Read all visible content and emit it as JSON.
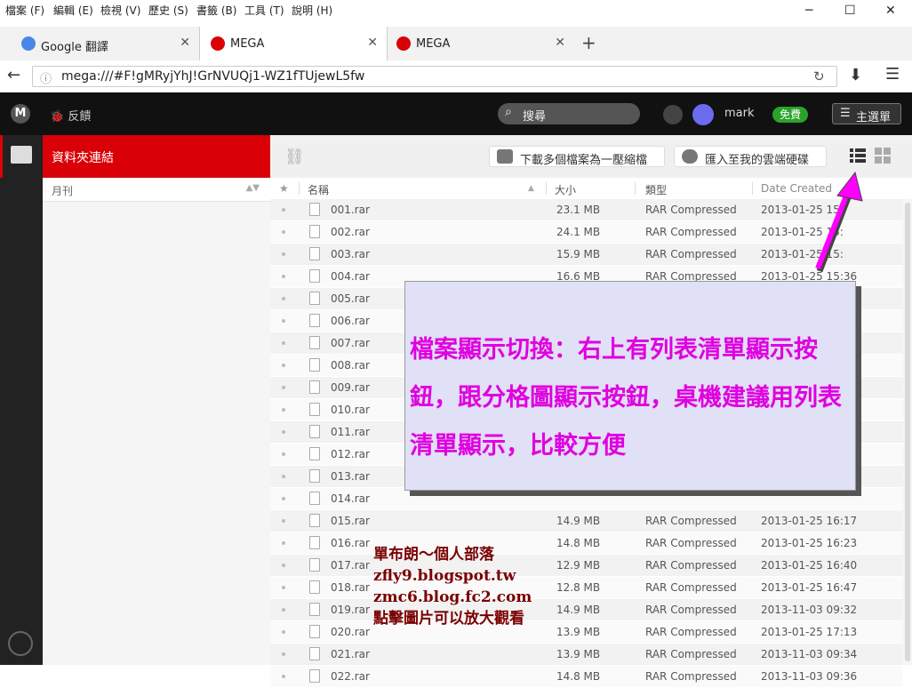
{
  "menubar": {
    "items": [
      "檔案 (F)",
      "編輯 (E)",
      "檢視 (V)",
      "歷史 (S)",
      "書籤 (B)",
      "工具 (T)",
      "說明 (H)"
    ]
  },
  "tabs": [
    {
      "label": "Google 翻譯",
      "icon": "google-translate-icon"
    },
    {
      "label": "MEGA",
      "icon": "mega-icon",
      "active": true
    },
    {
      "label": "MEGA",
      "icon": "mega-icon"
    }
  ],
  "url": "mega:///#F!gMRyjYhJ!GrNVUQj1-WZ1fTUjewL5fw",
  "mega": {
    "feedback": "反饋",
    "search_label": "搜尋",
    "username": "mark",
    "free_badge": "免費",
    "main_menu": "主選單"
  },
  "tree": {
    "header": "資料夾連結",
    "item": "月刊"
  },
  "toolbar": {
    "download_zip": "下載多個檔案為一壓縮檔",
    "import_cloud": "匯入至我的雲端硬碟"
  },
  "columns": {
    "name": "名稱",
    "size": "大小",
    "type": "類型",
    "date": "Date Created"
  },
  "files": [
    {
      "name": "001.rar",
      "size": "23.1 MB",
      "type": "RAR Compressed",
      "date": "2013-01-25 15:"
    },
    {
      "name": "002.rar",
      "size": "24.1 MB",
      "type": "RAR Compressed",
      "date": "2013-01-25 15:"
    },
    {
      "name": "003.rar",
      "size": "15.9 MB",
      "type": "RAR Compressed",
      "date": "2013-01-25 15:"
    },
    {
      "name": "004.rar",
      "size": "16.6 MB",
      "type": "RAR Compressed",
      "date": "2013-01-25 15:36"
    },
    {
      "name": "005.rar",
      "size": "",
      "type": "",
      "date": ""
    },
    {
      "name": "006.rar",
      "size": "",
      "type": "",
      "date": ""
    },
    {
      "name": "007.rar",
      "size": "",
      "type": "",
      "date": ""
    },
    {
      "name": "008.rar",
      "size": "",
      "type": "",
      "date": ""
    },
    {
      "name": "009.rar",
      "size": "",
      "type": "",
      "date": ""
    },
    {
      "name": "010.rar",
      "size": "",
      "type": "",
      "date": ""
    },
    {
      "name": "011.rar",
      "size": "",
      "type": "",
      "date": ""
    },
    {
      "name": "012.rar",
      "size": "",
      "type": "",
      "date": ""
    },
    {
      "name": "013.rar",
      "size": "",
      "type": "",
      "date": ""
    },
    {
      "name": "014.rar",
      "size": "",
      "type": "",
      "date": ""
    },
    {
      "name": "015.rar",
      "size": "14.9 MB",
      "type": "RAR Compressed",
      "date": "2013-01-25 16:17"
    },
    {
      "name": "016.rar",
      "size": "14.8 MB",
      "type": "RAR Compressed",
      "date": "2013-01-25 16:23"
    },
    {
      "name": "017.rar",
      "size": "12.9 MB",
      "type": "RAR Compressed",
      "date": "2013-01-25 16:40"
    },
    {
      "name": "018.rar",
      "size": "12.8 MB",
      "type": "RAR Compressed",
      "date": "2013-01-25 16:47"
    },
    {
      "name": "019.rar",
      "size": "14.9 MB",
      "type": "RAR Compressed",
      "date": "2013-11-03 09:32"
    },
    {
      "name": "020.rar",
      "size": "13.9 MB",
      "type": "RAR Compressed",
      "date": "2013-01-25 17:13"
    },
    {
      "name": "021.rar",
      "size": "13.9 MB",
      "type": "RAR Compressed",
      "date": "2013-11-03 09:34"
    },
    {
      "name": "022.rar",
      "size": "14.8 MB",
      "type": "RAR Compressed",
      "date": "2013-11-03 09:36"
    }
  ],
  "annotation": {
    "text": "檔案顯示切換：右上有列表清單顯示按鈕，跟分格圖顯示按鈕，桌機建議用列表清單顯示，比較方便"
  },
  "blog": {
    "line1": "單布朗～個人部落",
    "line2": "zfly9.blogspot.tw",
    "line3": "zmc6.blog.fc2.com",
    "line4": "點擊圖片可以放大觀看"
  },
  "colors": {
    "mega_red": "#d90007",
    "annotation_text": "#e000e0",
    "annotation_bg": "#e0e0f6",
    "free_green": "#2aa32a",
    "avatar": "#6b6bf0"
  }
}
